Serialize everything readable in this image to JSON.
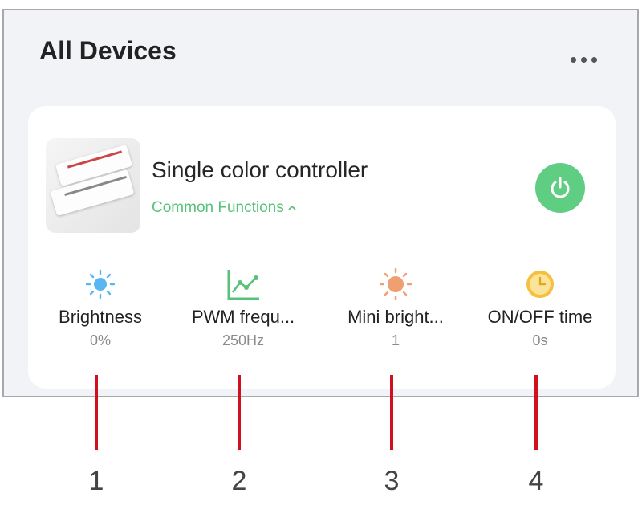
{
  "header": {
    "title": "All Devices"
  },
  "device": {
    "name": "Single color controller",
    "functions_link": "Common Functions",
    "power_state": "on"
  },
  "functions": [
    {
      "icon": "sun-icon",
      "label": "Brightness",
      "value": "0%",
      "color": "#5ab6f0"
    },
    {
      "icon": "line-chart-icon",
      "label": "PWM frequ...",
      "value": "250Hz",
      "color": "#56c27a"
    },
    {
      "icon": "sun-icon",
      "label": "Mini bright...",
      "value": "1",
      "color": "#f0a070"
    },
    {
      "icon": "clock-icon",
      "label": "ON/OFF time",
      "value": "0s",
      "color": "#f5c040"
    }
  ],
  "markers": [
    "1",
    "2",
    "3",
    "4"
  ],
  "colors": {
    "accent": "#5fce83",
    "marker": "#d0101e"
  }
}
